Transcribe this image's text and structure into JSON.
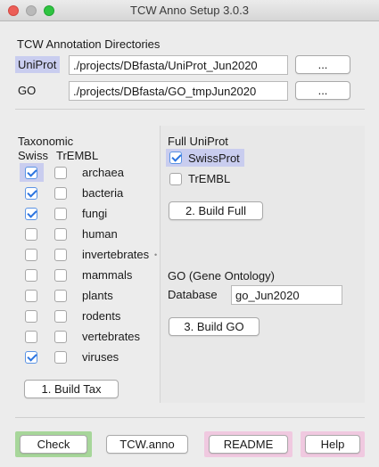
{
  "window": {
    "title": "TCW Anno Setup 3.0.3"
  },
  "directories": {
    "title": "TCW Annotation Directories",
    "uniprot_label": "UniProt",
    "uniprot_path": "./projects/DBfasta/UniProt_Jun2020",
    "go_label": "GO",
    "go_path": "./projects/DBfasta/GO_tmpJun2020",
    "browse_label": "..."
  },
  "taxonomic": {
    "title": "Taxonomic",
    "col_swiss": "Swiss",
    "col_trembl": "TrEMBL",
    "rows": [
      {
        "name": "archaea",
        "swiss": true,
        "trembl": false
      },
      {
        "name": "bacteria",
        "swiss": true,
        "trembl": false
      },
      {
        "name": "fungi",
        "swiss": true,
        "trembl": false
      },
      {
        "name": "human",
        "swiss": false,
        "trembl": false
      },
      {
        "name": "invertebrates",
        "swiss": false,
        "trembl": false
      },
      {
        "name": "mammals",
        "swiss": false,
        "trembl": false
      },
      {
        "name": "plants",
        "swiss": false,
        "trembl": false
      },
      {
        "name": "rodents",
        "swiss": false,
        "trembl": false
      },
      {
        "name": "vertebrates",
        "swiss": false,
        "trembl": false
      },
      {
        "name": "viruses",
        "swiss": true,
        "trembl": false
      }
    ],
    "build_label": "1. Build Tax"
  },
  "full_uniprot": {
    "title": "Full UniProt",
    "swissprot_label": "SwissProt",
    "swissprot_checked": true,
    "trembl_label": "TrEMBL",
    "trembl_checked": false,
    "build_label": "2. Build Full"
  },
  "go": {
    "title": "GO (Gene Ontology)",
    "database_label": "Database",
    "database_value": "go_Jun2020",
    "build_label": "3. Build GO"
  },
  "footer": {
    "check_label": "Check",
    "tcw_anno_label": "TCW.anno",
    "readme_label": "README",
    "help_label": "Help"
  },
  "colors": {
    "check_accent": "#a7d69a",
    "readme_accent": "#f0c9e0",
    "selection_highlight": "#c9cdef",
    "checkbox_blue": "#2b74e0"
  }
}
